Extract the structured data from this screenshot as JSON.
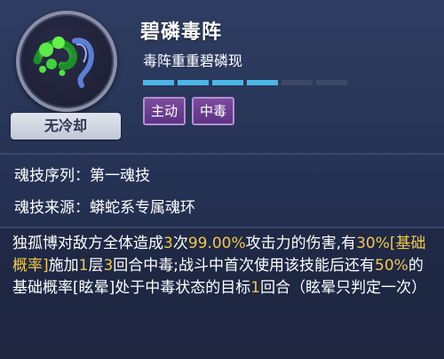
{
  "skill": {
    "name": "碧磷毒阵",
    "subtitle": "毒阵重重碧磷现",
    "cooldown_label": "无冷却",
    "icon": "green-poison-serpent-icon",
    "level": {
      "filled": 4,
      "total": 6
    },
    "tags": [
      "主动",
      "中毒"
    ]
  },
  "info": {
    "sequence_label": "魂技序列：",
    "sequence_value": "第一魂技",
    "source_label": "魂技来源：",
    "source_value": "蟒蛇系专属魂环"
  },
  "description": {
    "p1": "独孤博对敌方全体造成",
    "hits": "3",
    "p2": "次",
    "damage": "99.00%",
    "p3": "攻击力的伤害,有",
    "chance": "30%",
    "chance_tag": "[基础概率]",
    "p4": "施加",
    "stacks": "1",
    "p5": "层",
    "rounds": "3",
    "p6": "回合中毒;战斗中首次使用该技能后还有",
    "stun_chance": "50%",
    "p7": "的基础概率[眩晕]处于中毒状态的目标",
    "stun_rounds": "1",
    "p8": "回合（眩晕只判定一次）"
  },
  "colors": {
    "highlight": "#f2c84b",
    "tag_purple": "#6b3f90",
    "level_on": "#4bb6e6",
    "level_off": "#3d4866",
    "background": "#2a3658"
  }
}
